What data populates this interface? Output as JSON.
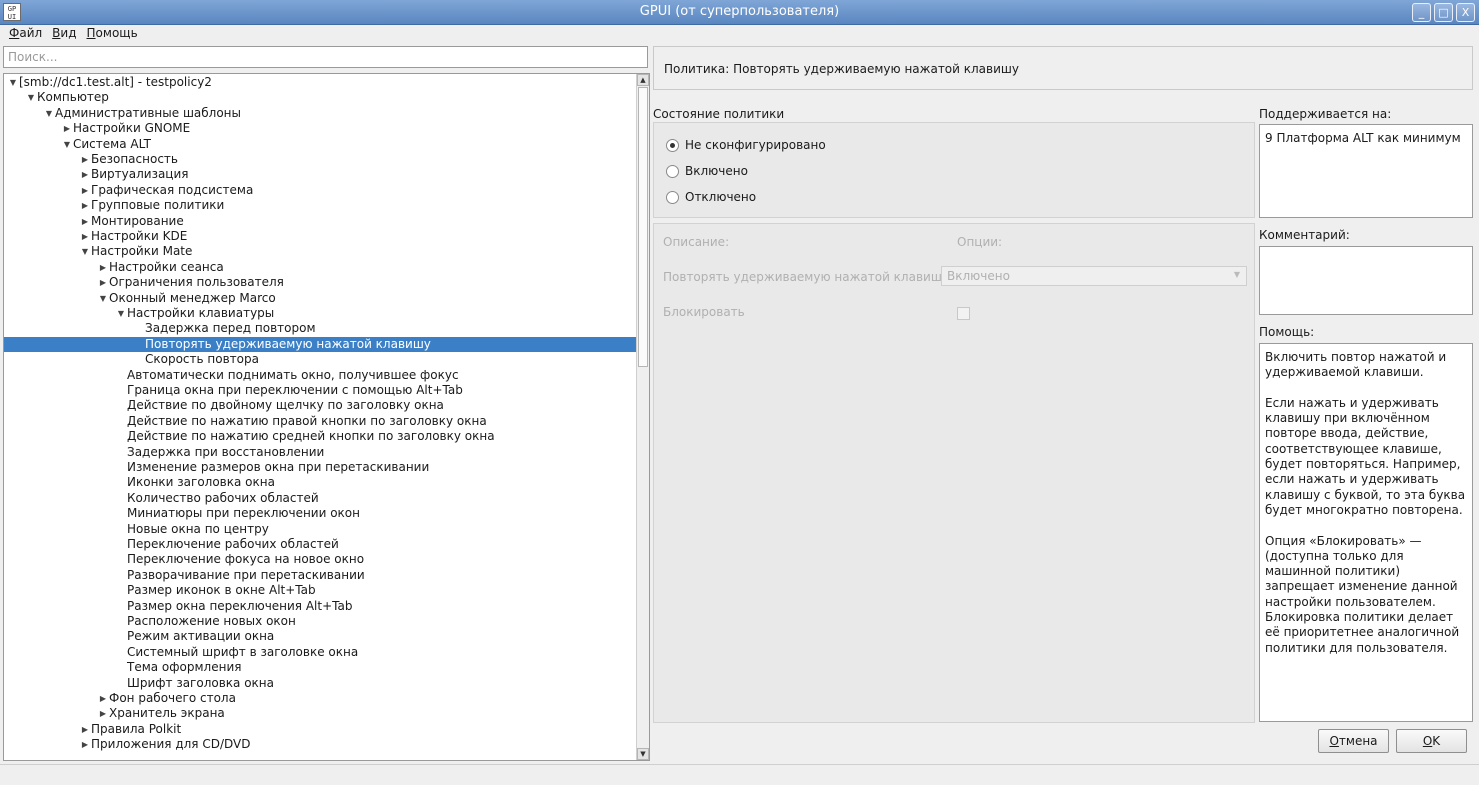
{
  "window": {
    "title": "GPUI (от суперпользователя)",
    "icon_text": "GP UI",
    "controls": [
      "_",
      "□",
      "X"
    ]
  },
  "menu": [
    {
      "label": "Файл"
    },
    {
      "label": "Вид"
    },
    {
      "label": "Помощь"
    }
  ],
  "search": {
    "placeholder": "Поиск...",
    "value": ""
  },
  "tree": [
    {
      "label": "[smb://dc1.test.alt] - testpolicy2",
      "level": 0,
      "expand": "open"
    },
    {
      "label": "Компьютер",
      "level": 1,
      "expand": "open"
    },
    {
      "label": "Административные шаблоны",
      "level": 2,
      "expand": "open"
    },
    {
      "label": "Настройки GNOME",
      "level": 3,
      "expand": "closed"
    },
    {
      "label": "Система ALT",
      "level": 3,
      "expand": "open"
    },
    {
      "label": "Безопасность",
      "level": 4,
      "expand": "closed"
    },
    {
      "label": "Виртуализация",
      "level": 4,
      "expand": "closed"
    },
    {
      "label": "Графическая подсистема",
      "level": 4,
      "expand": "closed"
    },
    {
      "label": "Групповые политики",
      "level": 4,
      "expand": "closed"
    },
    {
      "label": "Монтирование",
      "level": 4,
      "expand": "closed"
    },
    {
      "label": "Настройки KDE",
      "level": 4,
      "expand": "closed"
    },
    {
      "label": "Настройки Mate",
      "level": 4,
      "expand": "open"
    },
    {
      "label": "Настройки сеанса",
      "level": 5,
      "expand": "closed"
    },
    {
      "label": "Ограничения пользователя",
      "level": 5,
      "expand": "closed"
    },
    {
      "label": "Оконный менеджер Marco",
      "level": 5,
      "expand": "open"
    },
    {
      "label": "Настройки клавиатуры",
      "level": 6,
      "expand": "open"
    },
    {
      "label": "Задержка перед повтором",
      "level": 7,
      "expand": "none"
    },
    {
      "label": "Повторять удерживаемую нажатой клавишу",
      "level": 7,
      "expand": "none",
      "selected": true
    },
    {
      "label": "Скорость повтора",
      "level": 7,
      "expand": "none"
    },
    {
      "label": "Автоматически поднимать окно, получившее фокус",
      "level": 6,
      "expand": "none"
    },
    {
      "label": "Граница окна при переключении с помощью Alt+Tab",
      "level": 6,
      "expand": "none"
    },
    {
      "label": "Действие по двойному щелчку по заголовку окна",
      "level": 6,
      "expand": "none"
    },
    {
      "label": "Действие по нажатию правой кнопки по заголовку окна",
      "level": 6,
      "expand": "none"
    },
    {
      "label": "Действие по нажатию средней кнопки по заголовку окна",
      "level": 6,
      "expand": "none"
    },
    {
      "label": "Задержка при восстановлении",
      "level": 6,
      "expand": "none"
    },
    {
      "label": "Изменение размеров окна при перетаскивании",
      "level": 6,
      "expand": "none"
    },
    {
      "label": "Иконки заголовка окна",
      "level": 6,
      "expand": "none"
    },
    {
      "label": "Количество рабочих областей",
      "level": 6,
      "expand": "none"
    },
    {
      "label": "Миниатюры при переключении окон",
      "level": 6,
      "expand": "none"
    },
    {
      "label": "Новые окна по центру",
      "level": 6,
      "expand": "none"
    },
    {
      "label": "Переключение рабочих областей",
      "level": 6,
      "expand": "none"
    },
    {
      "label": "Переключение фокуса на новое окно",
      "level": 6,
      "expand": "none"
    },
    {
      "label": "Разворачивание при перетаскивании",
      "level": 6,
      "expand": "none"
    },
    {
      "label": "Размер иконок в окне Alt+Tab",
      "level": 6,
      "expand": "none"
    },
    {
      "label": "Размер окна переключения Alt+Tab",
      "level": 6,
      "expand": "none"
    },
    {
      "label": "Расположение новых окон",
      "level": 6,
      "expand": "none"
    },
    {
      "label": "Режим активации окна",
      "level": 6,
      "expand": "none"
    },
    {
      "label": "Системный шрифт в заголовке окна",
      "level": 6,
      "expand": "none"
    },
    {
      "label": "Тема оформления",
      "level": 6,
      "expand": "none"
    },
    {
      "label": "Шрифт заголовка окна",
      "level": 6,
      "expand": "none"
    },
    {
      "label": "Фон рабочего стола",
      "level": 5,
      "expand": "closed"
    },
    {
      "label": "Хранитель экрана",
      "level": 5,
      "expand": "closed"
    },
    {
      "label": "Правила Polkit",
      "level": 4,
      "expand": "closed"
    },
    {
      "label": "Приложения для CD/DVD",
      "level": 4,
      "expand": "closed"
    }
  ],
  "policy": {
    "header": "Политика: Повторять удерживаемую нажатой клавишу",
    "state_label": "Состояние политики",
    "states": [
      {
        "label": "Не сконфигурировано",
        "checked": true
      },
      {
        "label": "Включено",
        "checked": false
      },
      {
        "label": "Отключено",
        "checked": false
      }
    ],
    "description_label": "Описание:",
    "options_label": "Опции:",
    "option_name": "Повторять удерживаемую нажатой клавишу:",
    "option_value": "Включено",
    "lock_label": "Блокировать",
    "lock_checked": false
  },
  "supported": {
    "label": "Поддерживается на:",
    "value": "9 Платформа ALT как минимум"
  },
  "comment": {
    "label": "Комментарий:",
    "value": ""
  },
  "help": {
    "label": "Помощь:",
    "paragraphs": [
      "Включить повтор нажатой и удерживаемой клавиши.",
      "Если нажать и удерживать клавишу при включённом повторе ввода, действие, соответствующее клавише, будет повторяться. Например, если нажать и удерживать клавишу с буквой, то эта буква будет многократно повторена.",
      "Опция «Блокировать» — (доступна только для машинной политики) запрещает изменение данной настройки пользователем. Блокировка политики делает её приоритетнее аналогичной политики для пользователя."
    ]
  },
  "buttons": {
    "cancel": "Отмена",
    "ok": "OK"
  },
  "colors": {
    "selection": "#3b80c6",
    "titlebar": "#6d95cb"
  }
}
